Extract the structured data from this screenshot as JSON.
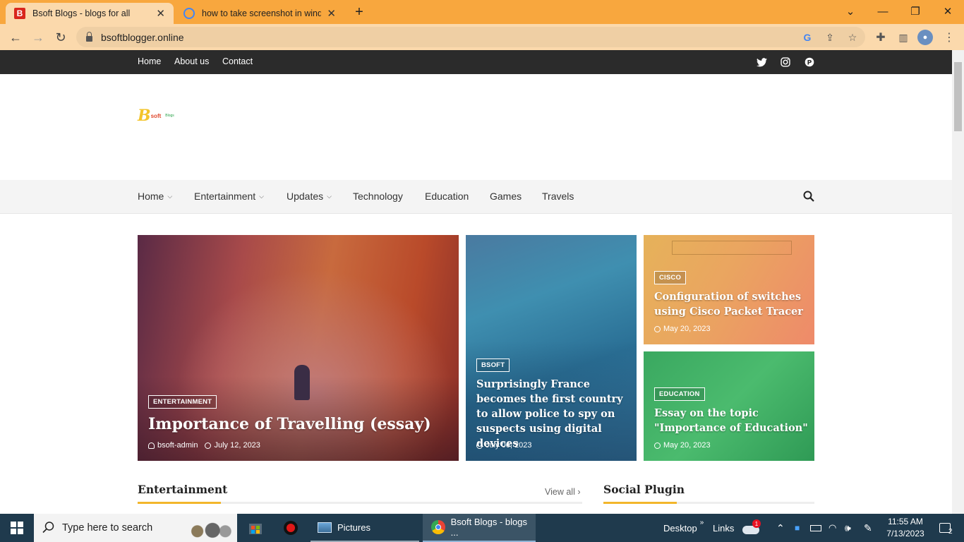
{
  "browser": {
    "tabs": [
      {
        "title": "Bsoft Blogs - blogs for all",
        "favicon": "B"
      },
      {
        "title": "how to take screenshot in windo",
        "favicon": "google"
      }
    ],
    "new_tab_symbol": "+",
    "url": "bsoftblogger.online"
  },
  "site": {
    "top_links": [
      "Home",
      "About us",
      "Contact"
    ],
    "logo": {
      "b": "B",
      "soft": "soft",
      "blogs": "Blogs"
    },
    "nav": [
      {
        "label": "Home",
        "dropdown": true
      },
      {
        "label": "Entertainment",
        "dropdown": true
      },
      {
        "label": "Updates",
        "dropdown": true
      },
      {
        "label": "Technology",
        "dropdown": false
      },
      {
        "label": "Education",
        "dropdown": false
      },
      {
        "label": "Games",
        "dropdown": false
      },
      {
        "label": "Travels",
        "dropdown": false
      }
    ],
    "featured": [
      {
        "category": "ENTERTAINMENT",
        "title": "Importance of Travelling (essay)",
        "author": "bsoft-admin",
        "date": "July 12, 2023"
      },
      {
        "category": "BSOFT",
        "title": "Surprisingly France becomes the first country to allow police to spy on suspects using digital devices",
        "date": "July 06, 2023"
      },
      {
        "category": "CISCO",
        "title": "Configuration of switches using Cisco Packet Tracer",
        "date": "May 20, 2023"
      },
      {
        "category": "EDUCATION",
        "title": "Essay on the topic \"Importance of Education\"",
        "date": "May 20, 2023"
      }
    ],
    "sections": {
      "entertainment": "Entertainment",
      "view_all": "View all",
      "social_plugin": "Social Plugin"
    },
    "accent_color": "#f3b62b"
  },
  "taskbar": {
    "search_placeholder": "Type here to search",
    "apps": [
      {
        "label": "Pictures"
      },
      {
        "label": "Bsoft Blogs - blogs ..."
      }
    ],
    "desktop": "Desktop",
    "links": "Links",
    "onedrive_badge": "1",
    "time": "11:55 AM",
    "date": "7/13/2023",
    "notification_count": "2"
  }
}
